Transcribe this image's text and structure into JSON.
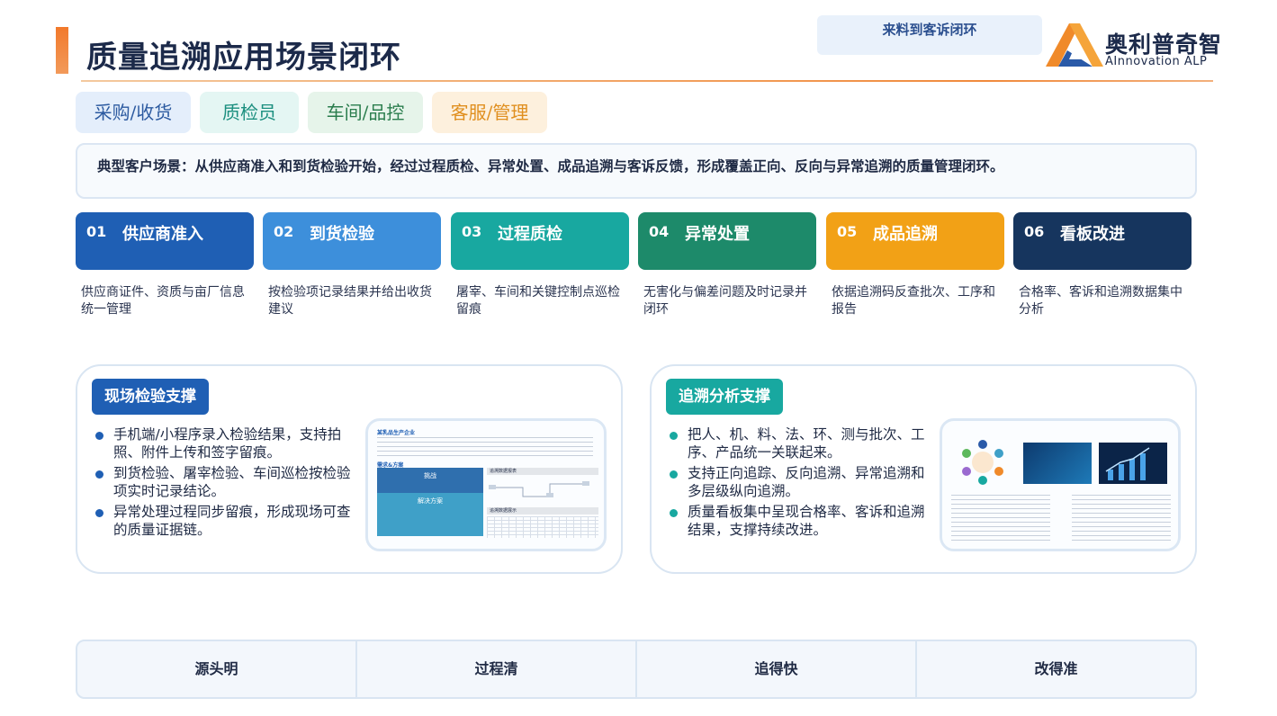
{
  "header": {
    "title": "质量追溯应用场景闭环",
    "badge": "来料到客诉闭环",
    "logo_cn": "奥利普奇智",
    "logo_en": "AInnovation ALP",
    "colors": {
      "accent_orange": "#f2792b",
      "title_navy": "#1c2a4a"
    }
  },
  "roles": [
    "采购/收货",
    "质检员",
    "车间/品控",
    "客服/管理"
  ],
  "scene": "典型客户场景：从供应商准入和到货检验开始，经过过程质检、异常处置、成品追溯与客诉反馈，形成覆盖正向、反向与异常追溯的质量管理闭环。",
  "steps": [
    {
      "num": "01",
      "title": "供应商准入",
      "desc": "供应商证件、资质与亩厂信息统一管理",
      "color": "#1f5fb4"
    },
    {
      "num": "02",
      "title": "到货检验",
      "desc": "按检验项记录结果并给出收货建议",
      "color": "#3d8fdb"
    },
    {
      "num": "03",
      "title": "过程质检",
      "desc": "屠宰、车间和关键控制点巡检留痕",
      "color": "#18a8a0"
    },
    {
      "num": "04",
      "title": "异常处置",
      "desc": "无害化与偏差问题及时记录并闭环",
      "color": "#1d8a6a"
    },
    {
      "num": "05",
      "title": "成品追溯",
      "desc": "依据追溯码反查批次、工序和报告",
      "color": "#f2a116"
    },
    {
      "num": "06",
      "title": "看板改进",
      "desc": "合格率、客诉和追溯数据集中分析",
      "color": "#16355e"
    }
  ],
  "panels": {
    "left": {
      "tag": "现场检验支撑",
      "tag_color": "#1f5fb4",
      "dot_color": "#1f5fb4",
      "bullets": [
        "手机端/小程序录入检验结果，支持拍照、附件上传和签字留痕。",
        "到货检验、屠宰检验、车间巡检按检验项实时记录结论。",
        "异常处理过程同步留痕，形成现场可查的质量证据链。"
      ],
      "thumb": {
        "heading": "某乳品生产企业",
        "section": "需求&方案",
        "challenge": "挑战",
        "solution": "解决方案",
        "right_head_1": "追溯数据报表",
        "right_head_2": "追溯数据展示"
      }
    },
    "right": {
      "tag": "追溯分析支撑",
      "tag_color": "#18a8a0",
      "dot_color": "#18a8a0",
      "bullets": [
        "把人、机、料、法、环、测与批次、工序、产品统一关联起来。",
        "支持正向追踪、反向追溯、异常追溯和多层级纵向追溯。",
        "质量看板集中呈现合格率、客诉和追溯结果，支撑持续改进。"
      ]
    }
  },
  "bottom": [
    "源头明",
    "过程清",
    "追得快",
    "改得准"
  ]
}
